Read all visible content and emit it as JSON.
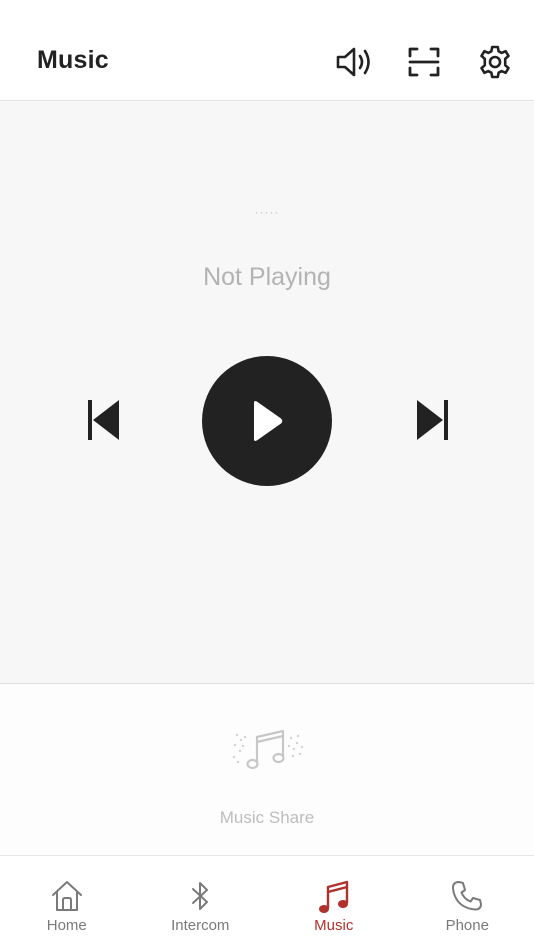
{
  "header": {
    "title": "Music",
    "icons": [
      "volume-icon",
      "scan-icon",
      "gear-icon"
    ]
  },
  "player": {
    "track_placeholder": "·····",
    "status": "Not Playing",
    "controls": [
      "previous-track-icon",
      "play-icon",
      "next-track-icon"
    ]
  },
  "share": {
    "label": "Music Share",
    "icon": "music-share-icon"
  },
  "tabs": [
    {
      "label": "Home",
      "icon": "home-icon",
      "active": false
    },
    {
      "label": "Intercom",
      "icon": "bluetooth-icon",
      "active": false
    },
    {
      "label": "Music",
      "icon": "music-note-icon",
      "active": true
    },
    {
      "label": "Phone",
      "icon": "phone-icon",
      "active": false
    }
  ],
  "colors": {
    "accent": "#b0312c",
    "dark": "#222222",
    "inactive": "#7a7a7a",
    "player_bg": "#f7f7f7"
  }
}
